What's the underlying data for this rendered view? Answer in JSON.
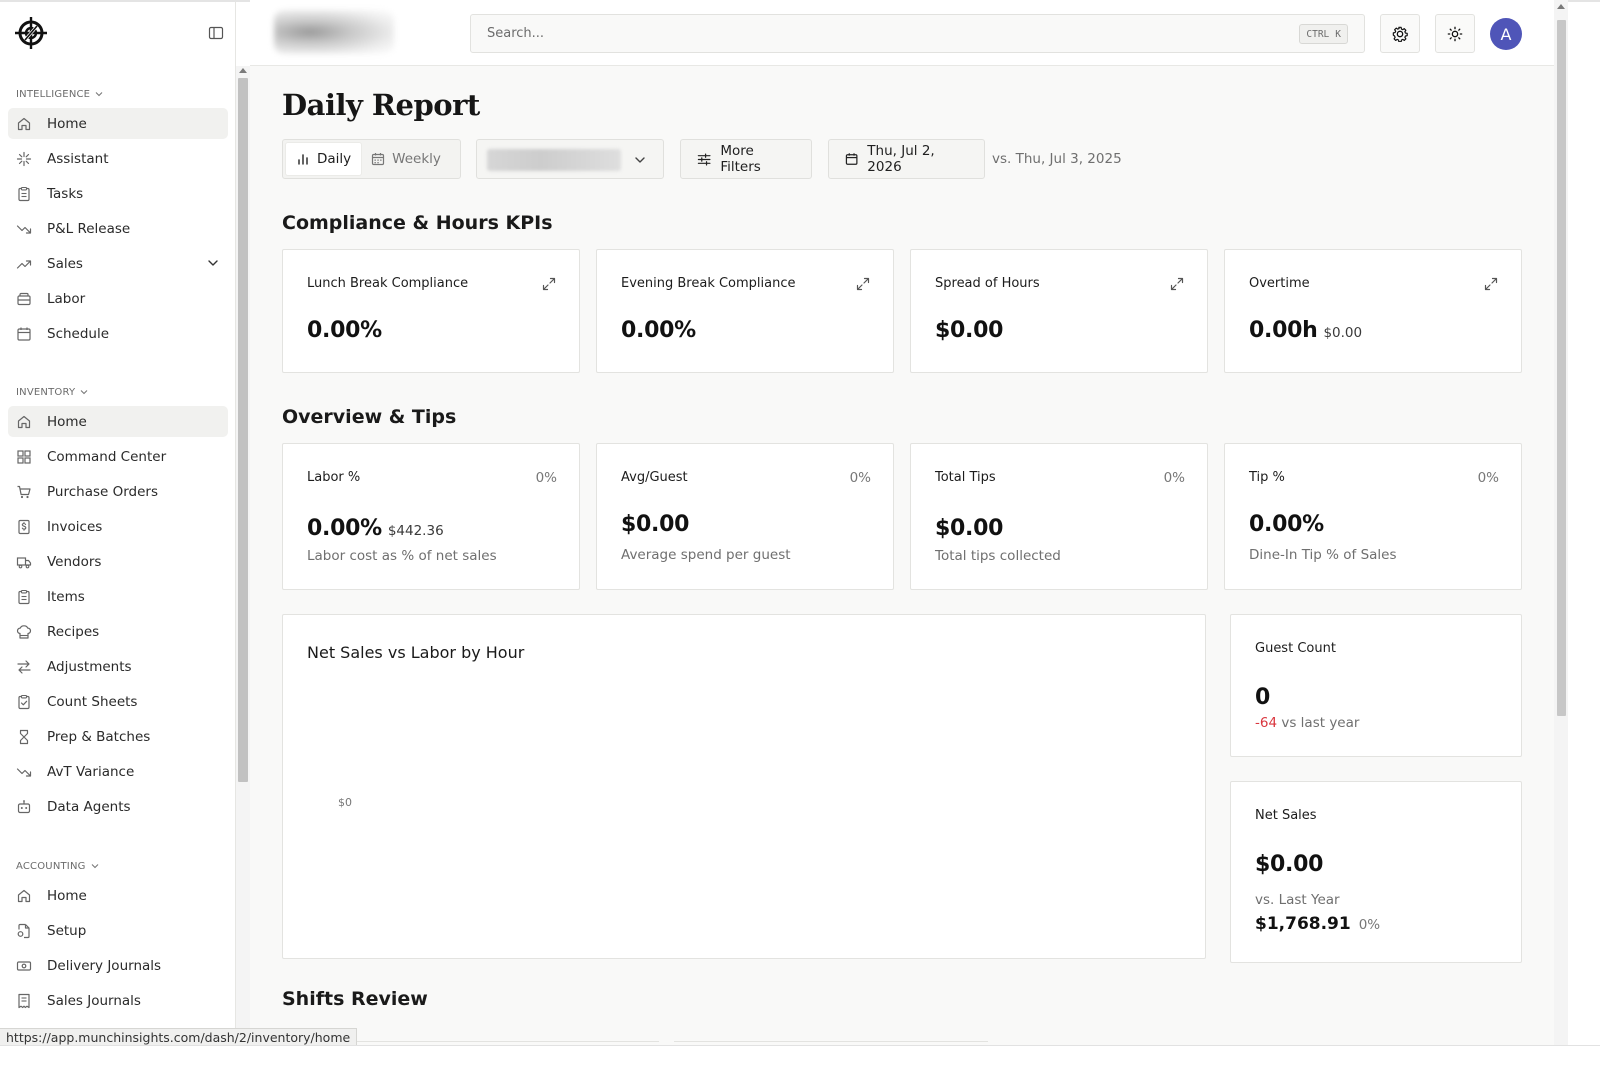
{
  "search": {
    "placeholder": "Search...",
    "shortcut_ctrl": "CTRL",
    "shortcut_key": "K"
  },
  "user": {
    "avatar_initial": "A"
  },
  "sidebar": {
    "sections": [
      {
        "title": "INTELLIGENCE",
        "items": [
          {
            "label": "Home",
            "icon": "home-icon",
            "active": true
          },
          {
            "label": "Assistant",
            "icon": "sparkle-icon"
          },
          {
            "label": "Tasks",
            "icon": "clipboard-icon"
          },
          {
            "label": "P&L Release",
            "icon": "trend-down-icon"
          },
          {
            "label": "Sales",
            "icon": "trend-up-icon",
            "expandable": true
          },
          {
            "label": "Labor",
            "icon": "box-icon"
          },
          {
            "label": "Schedule",
            "icon": "calendar-icon"
          }
        ]
      },
      {
        "title": "INVENTORY",
        "items": [
          {
            "label": "Home",
            "icon": "home-icon",
            "active": true
          },
          {
            "label": "Command Center",
            "icon": "grid-icon"
          },
          {
            "label": "Purchase Orders",
            "icon": "cart-icon"
          },
          {
            "label": "Invoices",
            "icon": "dollar-doc-icon"
          },
          {
            "label": "Vendors",
            "icon": "truck-icon"
          },
          {
            "label": "Items",
            "icon": "clipboard-icon"
          },
          {
            "label": "Recipes",
            "icon": "chef-hat-icon"
          },
          {
            "label": "Adjustments",
            "icon": "arrows-swap-icon"
          },
          {
            "label": "Count Sheets",
            "icon": "clipboard-check-icon"
          },
          {
            "label": "Prep & Batches",
            "icon": "hourglass-icon"
          },
          {
            "label": "AvT Variance",
            "icon": "trend-down-icon"
          },
          {
            "label": "Data Agents",
            "icon": "bot-icon"
          }
        ]
      },
      {
        "title": "ACCOUNTING",
        "items": [
          {
            "label": "Home",
            "icon": "home-icon"
          },
          {
            "label": "Setup",
            "icon": "file-cog-icon"
          },
          {
            "label": "Delivery Journals",
            "icon": "banknote-icon"
          },
          {
            "label": "Sales Journals",
            "icon": "receipt-icon"
          }
        ]
      }
    ]
  },
  "main": {
    "title": "Daily Report",
    "toolbar": {
      "daily_label": "Daily",
      "weekly_label": "Weekly",
      "more_filters_label": "More Filters",
      "date_label": "Thu, Jul 2, 2026",
      "compare_label": "vs. Thu, Jul 3, 2025"
    },
    "kpi_section": {
      "title": "Compliance & Hours KPIs",
      "cards": [
        {
          "label": "Lunch Break Compliance",
          "value": "0.00%"
        },
        {
          "label": "Evening Break Compliance",
          "value": "0.00%"
        },
        {
          "label": "Spread of Hours",
          "value": "$0.00"
        },
        {
          "label": "Overtime",
          "value": "0.00h",
          "sub": "$0.00"
        }
      ]
    },
    "overview_section": {
      "title": "Overview & Tips",
      "cards": [
        {
          "label": "Labor %",
          "change": "0%",
          "value": "0.00%",
          "sub": "$442.36",
          "desc": "Labor cost as % of net sales"
        },
        {
          "label": "Avg/Guest",
          "change": "0%",
          "value": "$0.00",
          "desc": "Average spend per guest"
        },
        {
          "label": "Total Tips",
          "change": "0%",
          "value": "$0.00",
          "desc": "Total tips collected"
        },
        {
          "label": "Tip %",
          "change": "0%",
          "value": "0.00%",
          "desc": "Dine-In Tip % of Sales"
        }
      ]
    },
    "chart": {
      "title": "Net Sales vs Labor by Hour"
    },
    "guest_count": {
      "label": "Guest Count",
      "value": "0",
      "delta": "-64",
      "delta_suffix": "vs last year"
    },
    "net_sales": {
      "label": "Net Sales",
      "value": "$0.00",
      "vs_label": "vs. Last Year",
      "last_year_value": "$1,768.91",
      "change": "0%"
    },
    "shifts_section": {
      "title": "Shifts Review"
    }
  },
  "status_bar": {
    "url": "https://app.munchinsights.com/dash/2/inventory/home"
  },
  "chart_data": {
    "type": "bar",
    "title": "Net Sales vs Labor by Hour",
    "categories": [],
    "series": [],
    "y_tick_labels": [
      "$0"
    ],
    "ylim": [
      0,
      0
    ],
    "grid": false
  },
  "colors": {
    "accent_avatar": "#4f55b8",
    "negative": "#d9363e",
    "background": "#f9f9f8"
  }
}
